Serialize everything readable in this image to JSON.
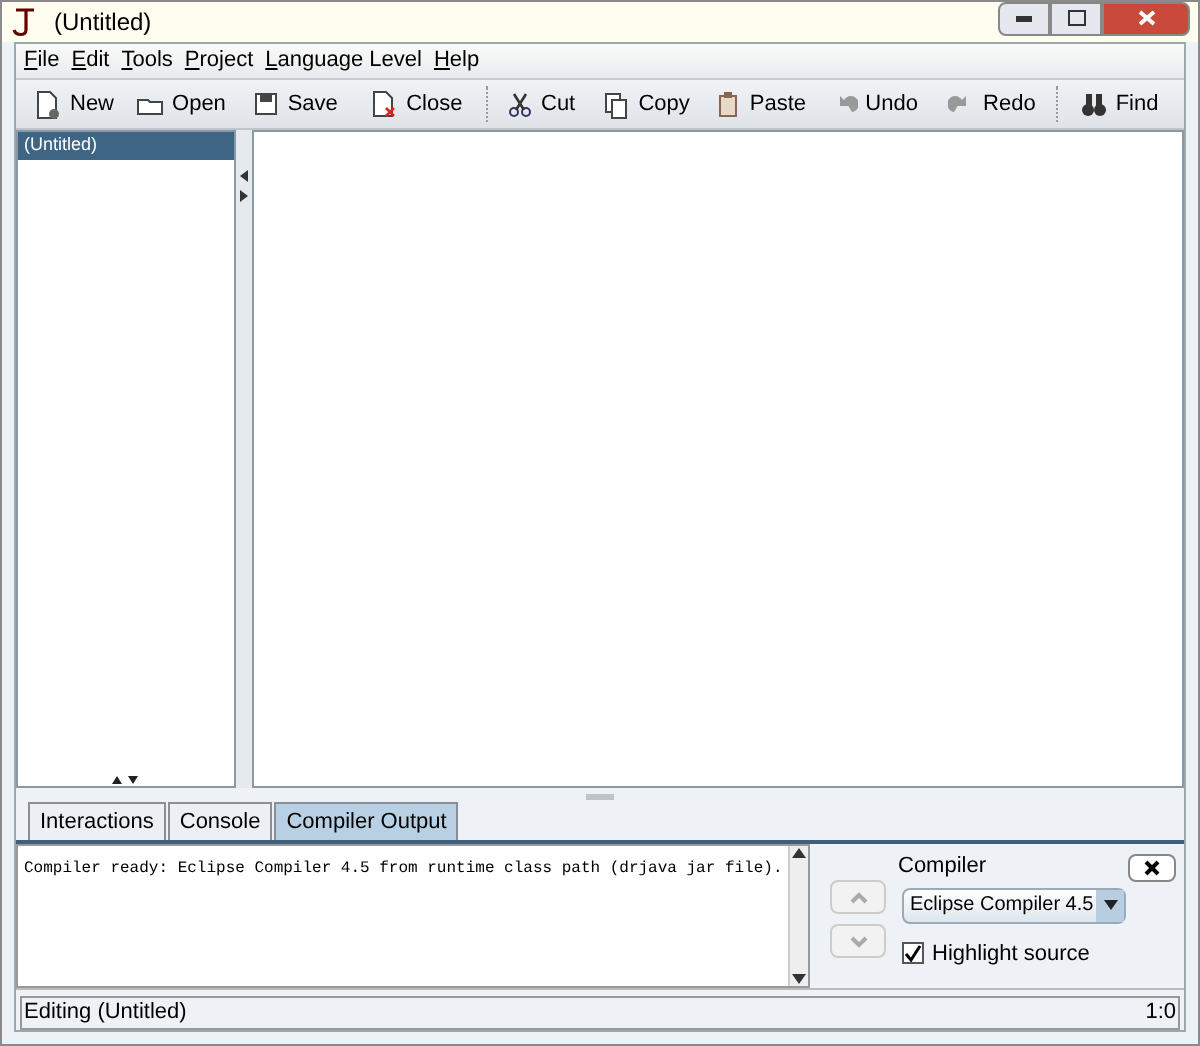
{
  "window": {
    "title": "(Untitled)"
  },
  "menu": [
    "File",
    "Edit",
    "Tools",
    "Project",
    "Language Level",
    "Help"
  ],
  "toolbar": [
    {
      "label": "New",
      "kind": "new"
    },
    {
      "label": "Open",
      "kind": "open"
    },
    {
      "label": "Save",
      "kind": "save"
    },
    {
      "label": "Close",
      "kind": "close"
    },
    {
      "label": "Cut",
      "kind": "cut"
    },
    {
      "label": "Copy",
      "kind": "copy"
    },
    {
      "label": "Paste",
      "kind": "paste"
    },
    {
      "label": "Undo",
      "kind": "undo"
    },
    {
      "label": "Redo",
      "kind": "redo"
    },
    {
      "label": "Find",
      "kind": "find"
    }
  ],
  "files": [
    {
      "name": "(Untitled)",
      "selected": true
    }
  ],
  "tabs": [
    {
      "label": "Interactions",
      "selected": false
    },
    {
      "label": "Console",
      "selected": false
    },
    {
      "label": "Compiler Output",
      "selected": true
    }
  ],
  "output": "Compiler ready: Eclipse Compiler 4.5 from runtime class path (drjava jar file).",
  "compiler": {
    "label": "Compiler",
    "value": "Eclipse Compiler 4.5",
    "highlight_label": "Highlight source",
    "highlight_checked": true
  },
  "status_bar": {
    "text": "Editing (Untitled)",
    "position": "1:0"
  }
}
